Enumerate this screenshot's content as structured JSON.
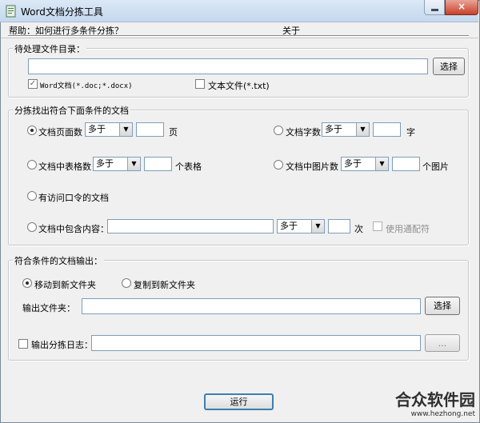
{
  "window": {
    "title": "Word文档分拣工具",
    "close_glyph": "×"
  },
  "menu": {
    "help": "帮助：如何进行多条件分拣？",
    "about": "关于"
  },
  "source": {
    "group_label": "待处理文件目录：",
    "path_value": "",
    "browse_label": "选择",
    "word_check_label": "Word文档(*.doc;*.docx)",
    "word_checked": true,
    "text_check_label": "文本文件(*.txt)",
    "text_checked": false
  },
  "filters": {
    "group_label": "分拣找出符合下面条件的文档",
    "page_count": {
      "label": "文档页面数",
      "mode": "多于",
      "value": "",
      "unit": "页",
      "selected": true
    },
    "word_count": {
      "label": "文档字数",
      "mode": "多于",
      "value": "",
      "unit": "字",
      "selected": false
    },
    "table_count": {
      "label": "文档中表格数",
      "mode": "多于",
      "value": "",
      "unit": "个表格",
      "selected": false
    },
    "image_count": {
      "label": "文档中图片数",
      "mode": "多于",
      "value": "",
      "unit": "个图片",
      "selected": false
    },
    "password": {
      "label": "有访问口令的文档",
      "selected": false
    },
    "content": {
      "label": "文档中包含内容：",
      "text": "",
      "mode": "多于",
      "value": "",
      "unit": "次",
      "selected": false,
      "wildcard_label": "使用通配符",
      "wildcard_checked": false
    }
  },
  "output": {
    "group_label": "符合条件的文档输出：",
    "move_label": "移动到新文件夹",
    "move_selected": true,
    "copy_label": "复制到新文件夹",
    "copy_selected": false,
    "folder_label": "输出文件夹：",
    "folder_value": "",
    "folder_browse_label": "选择",
    "log_label": "输出分拣日志：",
    "log_checked": false,
    "log_value": "",
    "log_browse_label": "..."
  },
  "run_label": "运行",
  "watermark": {
    "logo": "合众软件园",
    "url": "www.hezhong.net"
  },
  "icons": {
    "app": "document-icon",
    "dropdown": "chevron-down-icon",
    "check": "checkmark-icon"
  }
}
